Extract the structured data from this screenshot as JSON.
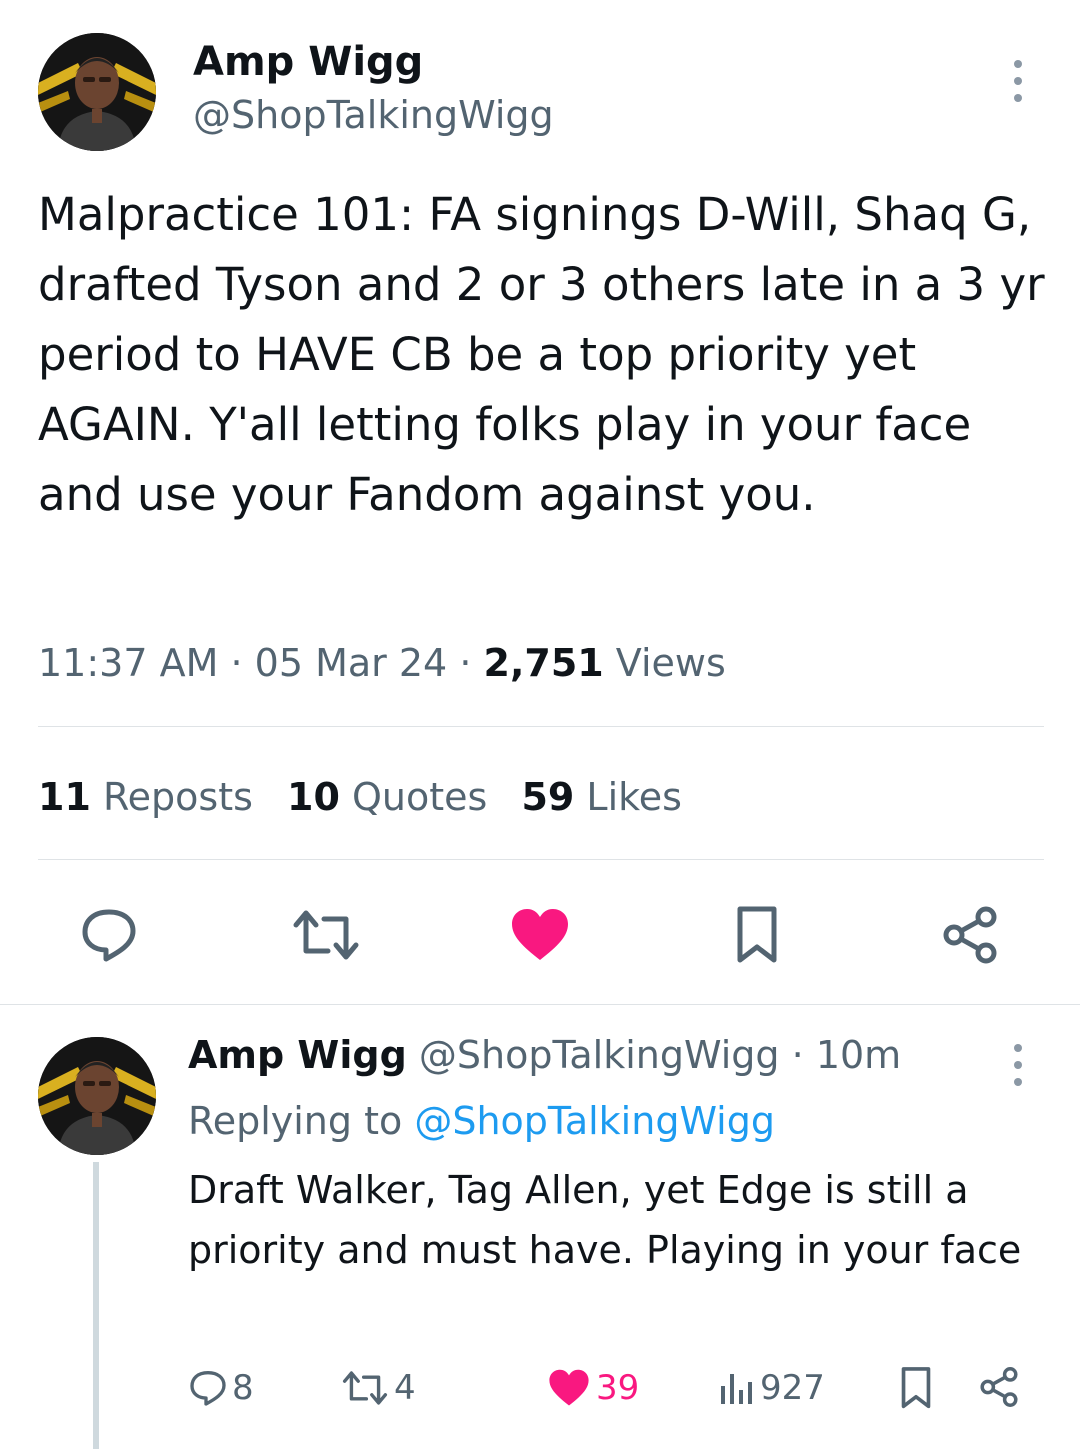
{
  "tweet": {
    "author_name": "Amp Wigg",
    "author_handle": "@ShopTalkingWigg",
    "text": "Malpractice 101: FA signings D-Will, Shaq G, drafted Tyson and 2 or 3 others late in a 3 yr period to HAVE CB be a top priority yet AGAIN. Y'all letting folks play in your face and use your Fandom against you.",
    "time": "11:37 AM",
    "date": "05 Mar 24",
    "sep": "·",
    "views_count": "2,751",
    "views_label": "Views",
    "reposts_count": "11",
    "reposts_label": "Reposts",
    "quotes_count": "10",
    "quotes_label": "Quotes",
    "likes_count": "59",
    "likes_label": "Likes"
  },
  "reply": {
    "author_name": "Amp Wigg",
    "author_handle": "@ShopTalkingWigg",
    "age": "10m",
    "sep": "·",
    "replying_label": "Replying to",
    "replying_handle": "@ShopTalkingWigg",
    "text": "Draft Walker, Tag Allen, yet Edge is still a priority and must have. Playing in your face",
    "reply_count": "8",
    "repost_count": "4",
    "like_count": "39",
    "view_count": "927"
  },
  "colors": {
    "like": "#f91880",
    "link": "#1d9bf0",
    "muted": "#536471",
    "divider": "#dfe3e6"
  },
  "icons": [
    "more-icon",
    "reply-icon",
    "repost-icon",
    "heart-icon",
    "bookmark-icon",
    "share-icon",
    "views-icon"
  ]
}
